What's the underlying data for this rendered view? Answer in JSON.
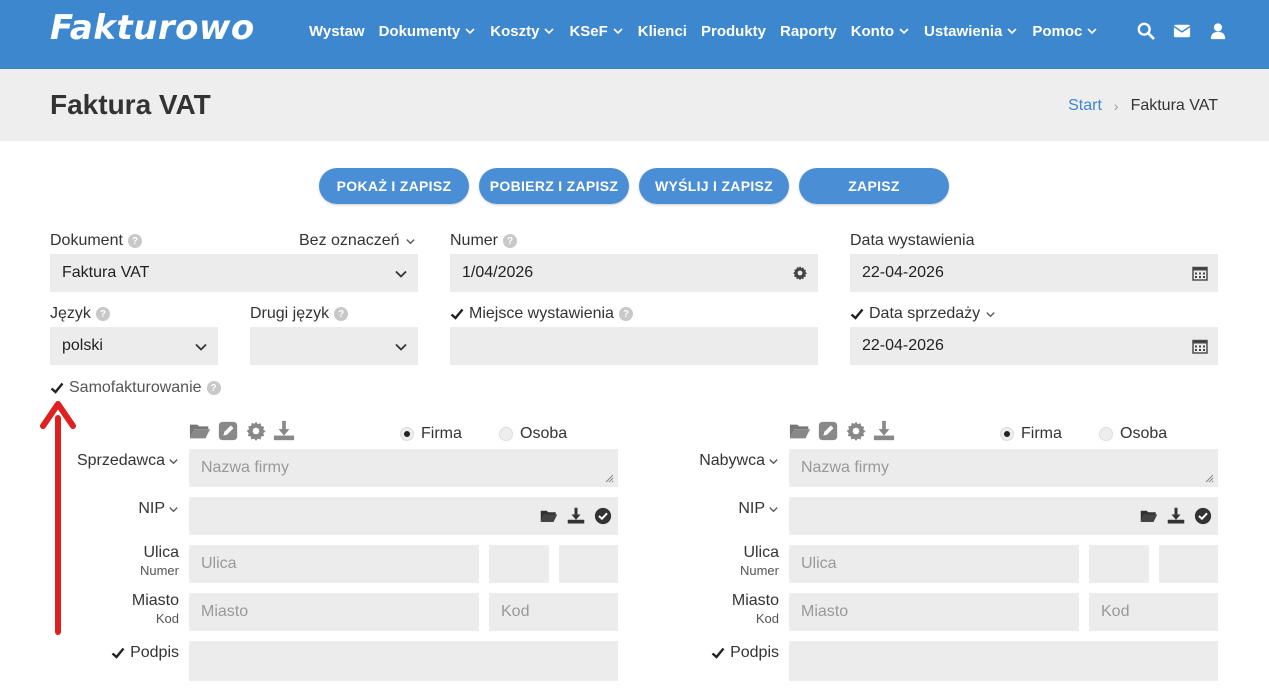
{
  "navbar": {
    "logo": "Fakturowo",
    "menu": [
      {
        "label": "Wystaw",
        "dropdown": false
      },
      {
        "label": "Dokumenty",
        "dropdown": true
      },
      {
        "label": "Koszty",
        "dropdown": true
      },
      {
        "label": "KSeF",
        "dropdown": true
      },
      {
        "label": "Klienci",
        "dropdown": false
      },
      {
        "label": "Produkty",
        "dropdown": false
      },
      {
        "label": "Raporty",
        "dropdown": false
      },
      {
        "label": "Konto",
        "dropdown": true
      },
      {
        "label": "Ustawienia",
        "dropdown": true
      },
      {
        "label": "Pomoc",
        "dropdown": true
      }
    ],
    "icons": [
      "search-icon",
      "envelope-icon",
      "user-icon"
    ],
    "color": "#3c87ce"
  },
  "header": {
    "title": "Faktura VAT",
    "breadcrumb": {
      "start": "Start",
      "current": "Faktura VAT"
    }
  },
  "actions": {
    "show_save": "POKAŻ I ZAPISZ",
    "download_save": "POBIERZ I ZAPISZ",
    "send_save": "WYŚLIJ I ZAPISZ",
    "save": "ZAPISZ"
  },
  "form": {
    "dokument": {
      "label": "Dokument",
      "value": "Faktura VAT",
      "marking": "Bez oznaczeń"
    },
    "numer": {
      "label": "Numer",
      "value": "1/04/2026"
    },
    "data_wystawienia": {
      "label": "Data wystawienia",
      "value": "22-04-2026"
    },
    "jezyk": {
      "label": "Język",
      "value": "polski"
    },
    "drugi_jezyk": {
      "label": "Drugi język",
      "value": ""
    },
    "miejsce_wystawienia": {
      "label": "Miejsce wystawienia",
      "checked": true,
      "value": ""
    },
    "data_sprzedazy": {
      "label": "Data sprzedaży",
      "checked": true,
      "value": "22-04-2026"
    },
    "samofakturowanie": {
      "label": "Samofakturowanie",
      "checked": true
    }
  },
  "seller": {
    "label": "Sprzedawca",
    "type_firma": "Firma",
    "type_osoba": "Osoba",
    "selected_type": "Firma",
    "name_placeholder": "Nazwa firmy",
    "nip_label": "NIP",
    "street_label": "Ulica",
    "street_sub": "Numer",
    "street_placeholder": "Ulica",
    "city_label": "Miasto",
    "city_sub": "Kod",
    "city_placeholder": "Miasto",
    "code_placeholder": "Kod",
    "signature_label": "Podpis",
    "signature_checked": true
  },
  "buyer": {
    "label": "Nabywca",
    "type_firma": "Firma",
    "type_osoba": "Osoba",
    "selected_type": "Firma",
    "name_placeholder": "Nazwa firmy",
    "nip_label": "NIP",
    "street_label": "Ulica",
    "street_sub": "Numer",
    "street_placeholder": "Ulica",
    "city_label": "Miasto",
    "city_sub": "Kod",
    "city_placeholder": "Miasto",
    "code_placeholder": "Kod",
    "signature_label": "Podpis",
    "signature_checked": true
  },
  "colors": {
    "accent": "#3c87ce",
    "button": "#4a8fd6",
    "field_bg": "#ececec",
    "annotation_arrow": "#e02020"
  }
}
